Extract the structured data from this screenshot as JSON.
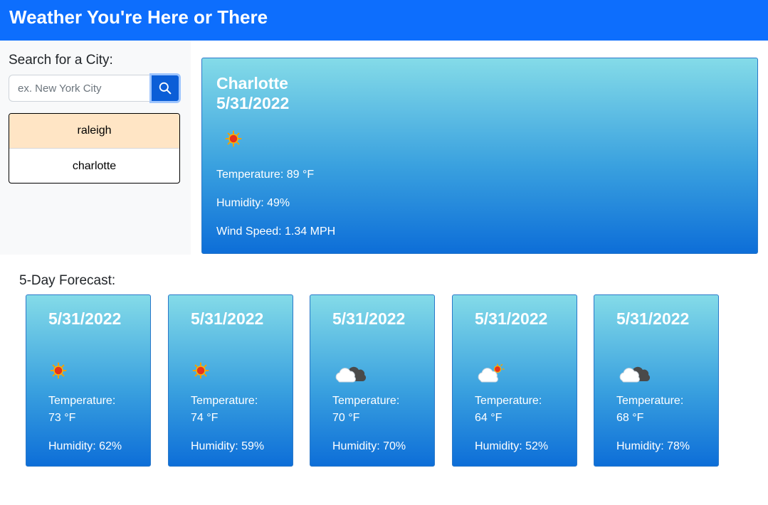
{
  "header": {
    "title": "Weather You're Here or There"
  },
  "sidebar": {
    "search_label": "Search for a City:",
    "search_placeholder": "ex. New York City",
    "search_value": "",
    "history": [
      {
        "label": "raleigh",
        "active": true
      },
      {
        "label": "charlotte",
        "active": false
      }
    ]
  },
  "current": {
    "city": "Charlotte",
    "date": "5/31/2022",
    "icon": "sun-icon",
    "temperature": "Temperature: 89 °F",
    "humidity": "Humidity: 49%",
    "wind": "Wind Speed: 1.34 MPH"
  },
  "forecast": {
    "title": "5-Day Forecast:",
    "days": [
      {
        "date": "5/31/2022",
        "icon": "sun-icon",
        "temp_label": "Temperature:",
        "temp_value": "73 °F",
        "humidity": "Humidity: 62%"
      },
      {
        "date": "5/31/2022",
        "icon": "sun-icon",
        "temp_label": "Temperature:",
        "temp_value": "74 °F",
        "humidity": "Humidity: 59%"
      },
      {
        "date": "5/31/2022",
        "icon": "cloudy-icon",
        "temp_label": "Temperature:",
        "temp_value": "70 °F",
        "humidity": "Humidity: 70%"
      },
      {
        "date": "5/31/2022",
        "icon": "partly-cloudy-icon",
        "temp_label": "Temperature:",
        "temp_value": "64 °F",
        "humidity": "Humidity: 52%"
      },
      {
        "date": "5/31/2022",
        "icon": "cloudy-icon",
        "temp_label": "Temperature:",
        "temp_value": "68 °F",
        "humidity": "Humidity: 78%"
      }
    ]
  },
  "colors": {
    "header": "#0d6efd",
    "search_button": "#0b5ed7",
    "active_history": "#ffe5c5",
    "card_gradient_top": "#84dbe8",
    "card_gradient_bottom": "#0d6ed8"
  }
}
